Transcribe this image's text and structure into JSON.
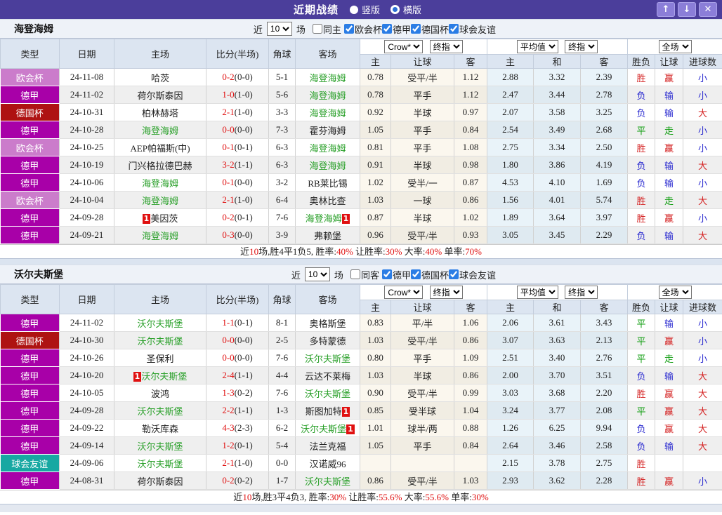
{
  "titlebar": {
    "title": "近期战绩",
    "radios": [
      {
        "label": "竖版",
        "selected": true
      },
      {
        "label": "横版",
        "selected": false
      }
    ],
    "buttons": {
      "up": "↑",
      "down": "↓",
      "close": "✕"
    }
  },
  "shared": {
    "near_label": "近",
    "games_label": "场",
    "columns_left": [
      "类型",
      "日期",
      "主场",
      "比分(半场)",
      "角球",
      "客场"
    ],
    "columns_right": [
      "主",
      "让球",
      "客",
      "主",
      "和",
      "客",
      "胜负",
      "让球",
      "进球数"
    ],
    "dropdowns": {
      "company": "Crow*",
      "final1": "终指",
      "average": "平均值",
      "final2": "终指",
      "scope": "全场"
    },
    "card_label": "1",
    "league_colors": {
      "欧会杯": "#cb7ccb",
      "德甲": "#a800a8",
      "德国杯": "#ae1212",
      "球会友谊": "#17a8a2"
    },
    "result_colors": {
      "胜": "#d42222",
      "赢": "#d42222",
      "大": "#d42222",
      "负": "#2b2bd0",
      "输": "#2b2bd0",
      "小": "#2b2bd0",
      "平": "#0f9d0f",
      "走": "#0f9d0f"
    },
    "colors": {
      "titlebar_purple": "#4b3e9b",
      "checkbox_blue": "#2b7de5",
      "score_red": "#e01010",
      "team_green": "#2aa02a"
    }
  },
  "tables": [
    {
      "team": "海登海姆",
      "games_count": "10",
      "same_side_label": "同主",
      "filters": [
        "欧会杯",
        "德甲",
        "德国杯",
        "球会友谊"
      ],
      "rows": [
        {
          "league": "欧会杯",
          "date": "24-11-08",
          "home": {
            "name": "哈茨",
            "green": false,
            "card": false
          },
          "score": "0-2",
          "half": "(0-0)",
          "corners": "5-1",
          "away": {
            "name": "海登海姆",
            "green": true,
            "card": false
          },
          "crow": [
            "0.78",
            "受平/半",
            "1.12"
          ],
          "avg": [
            "2.88",
            "3.32",
            "2.39"
          ],
          "results": [
            "胜",
            "赢",
            "小"
          ]
        },
        {
          "league": "德甲",
          "date": "24-11-02",
          "home": {
            "name": "荷尔斯泰因",
            "green": false,
            "card": false
          },
          "score": "1-0",
          "half": "(1-0)",
          "corners": "5-6",
          "away": {
            "name": "海登海姆",
            "green": true,
            "card": false
          },
          "crow": [
            "0.78",
            "平手",
            "1.12"
          ],
          "avg": [
            "2.47",
            "3.44",
            "2.78"
          ],
          "results": [
            "负",
            "输",
            "小"
          ]
        },
        {
          "league": "德国杯",
          "date": "24-10-31",
          "home": {
            "name": "柏林赫塔",
            "green": false,
            "card": false
          },
          "score": "2-1",
          "half": "(1-0)",
          "corners": "3-3",
          "away": {
            "name": "海登海姆",
            "green": true,
            "card": false
          },
          "crow": [
            "0.92",
            "半球",
            "0.97"
          ],
          "avg": [
            "2.07",
            "3.58",
            "3.25"
          ],
          "results": [
            "负",
            "输",
            "大"
          ]
        },
        {
          "league": "德甲",
          "date": "24-10-28",
          "home": {
            "name": "海登海姆",
            "green": true,
            "card": false
          },
          "score": "0-0",
          "half": "(0-0)",
          "corners": "7-3",
          "away": {
            "name": "霍芬海姆",
            "green": false,
            "card": false
          },
          "crow": [
            "1.05",
            "平手",
            "0.84"
          ],
          "avg": [
            "2.54",
            "3.49",
            "2.68"
          ],
          "results": [
            "平",
            "走",
            "小"
          ]
        },
        {
          "league": "欧会杯",
          "date": "24-10-25",
          "home": {
            "name": "AEP帕福斯(中)",
            "green": false,
            "card": false
          },
          "score": "0-1",
          "half": "(0-1)",
          "corners": "6-3",
          "away": {
            "name": "海登海姆",
            "green": true,
            "card": false
          },
          "crow": [
            "0.81",
            "平手",
            "1.08"
          ],
          "avg": [
            "2.75",
            "3.34",
            "2.50"
          ],
          "results": [
            "胜",
            "赢",
            "小"
          ]
        },
        {
          "league": "德甲",
          "date": "24-10-19",
          "home": {
            "name": "门兴格拉德巴赫",
            "green": false,
            "card": false
          },
          "score": "3-2",
          "half": "(1-1)",
          "corners": "6-3",
          "away": {
            "name": "海登海姆",
            "green": true,
            "card": false
          },
          "crow": [
            "0.91",
            "半球",
            "0.98"
          ],
          "avg": [
            "1.80",
            "3.86",
            "4.19"
          ],
          "results": [
            "负",
            "输",
            "大"
          ]
        },
        {
          "league": "德甲",
          "date": "24-10-06",
          "home": {
            "name": "海登海姆",
            "green": true,
            "card": false
          },
          "score": "0-1",
          "half": "(0-0)",
          "corners": "3-2",
          "away": {
            "name": "RB莱比锡",
            "green": false,
            "card": false
          },
          "crow": [
            "1.02",
            "受半/一",
            "0.87"
          ],
          "avg": [
            "4.53",
            "4.10",
            "1.69"
          ],
          "results": [
            "负",
            "输",
            "小"
          ]
        },
        {
          "league": "欧会杯",
          "date": "24-10-04",
          "home": {
            "name": "海登海姆",
            "green": true,
            "card": false
          },
          "score": "2-1",
          "half": "(1-0)",
          "corners": "6-4",
          "away": {
            "name": "奥林比查",
            "green": false,
            "card": false
          },
          "crow": [
            "1.03",
            "一球",
            "0.86"
          ],
          "avg": [
            "1.56",
            "4.01",
            "5.74"
          ],
          "results": [
            "胜",
            "走",
            "大"
          ]
        },
        {
          "league": "德甲",
          "date": "24-09-28",
          "home": {
            "name": "美因茨",
            "green": false,
            "card": true
          },
          "score": "0-2",
          "half": "(0-1)",
          "corners": "7-6",
          "away": {
            "name": "海登海姆",
            "green": true,
            "card": true
          },
          "crow": [
            "0.87",
            "半球",
            "1.02"
          ],
          "avg": [
            "1.89",
            "3.64",
            "3.97"
          ],
          "results": [
            "胜",
            "赢",
            "小"
          ]
        },
        {
          "league": "德甲",
          "date": "24-09-21",
          "home": {
            "name": "海登海姆",
            "green": true,
            "card": false
          },
          "score": "0-3",
          "half": "(0-0)",
          "corners": "3-9",
          "away": {
            "name": "弗赖堡",
            "green": false,
            "card": false
          },
          "crow": [
            "0.96",
            "受平/半",
            "0.93"
          ],
          "avg": [
            "3.05",
            "3.45",
            "2.29"
          ],
          "results": [
            "负",
            "输",
            "大"
          ]
        }
      ],
      "summary": [
        {
          "text": "近",
          "red": false
        },
        {
          "text": "10",
          "red": true
        },
        {
          "text": "场,胜4平1负5, 胜率:",
          "red": false
        },
        {
          "text": "40%",
          "red": true
        },
        {
          "text": " 让胜率:",
          "red": false
        },
        {
          "text": "30%",
          "red": true
        },
        {
          "text": " 大率:",
          "red": false
        },
        {
          "text": "40%",
          "red": true
        },
        {
          "text": " 单率:",
          "red": false
        },
        {
          "text": "70%",
          "red": true
        }
      ]
    },
    {
      "team": "沃尔夫斯堡",
      "games_count": "10",
      "same_side_label": "同客",
      "filters": [
        "德甲",
        "德国杯",
        "球会友谊"
      ],
      "rows": [
        {
          "league": "德甲",
          "date": "24-11-02",
          "home": {
            "name": "沃尔夫斯堡",
            "green": true,
            "card": false
          },
          "score": "1-1",
          "half": "(0-1)",
          "corners": "8-1",
          "away": {
            "name": "奥格斯堡",
            "green": false,
            "card": false
          },
          "crow": [
            "0.83",
            "平/半",
            "1.06"
          ],
          "avg": [
            "2.06",
            "3.61",
            "3.43"
          ],
          "results": [
            "平",
            "输",
            "小"
          ]
        },
        {
          "league": "德国杯",
          "date": "24-10-30",
          "home": {
            "name": "沃尔夫斯堡",
            "green": true,
            "card": false
          },
          "score": "0-0",
          "half": "(0-0)",
          "corners": "2-5",
          "away": {
            "name": "多特蒙德",
            "green": false,
            "card": false
          },
          "crow": [
            "1.03",
            "受平/半",
            "0.86"
          ],
          "avg": [
            "3.07",
            "3.63",
            "2.13"
          ],
          "results": [
            "平",
            "赢",
            "小"
          ]
        },
        {
          "league": "德甲",
          "date": "24-10-26",
          "home": {
            "name": "圣保利",
            "green": false,
            "card": false
          },
          "score": "0-0",
          "half": "(0-0)",
          "corners": "7-6",
          "away": {
            "name": "沃尔夫斯堡",
            "green": true,
            "card": false
          },
          "crow": [
            "0.80",
            "平手",
            "1.09"
          ],
          "avg": [
            "2.51",
            "3.40",
            "2.76"
          ],
          "results": [
            "平",
            "走",
            "小"
          ]
        },
        {
          "league": "德甲",
          "date": "24-10-20",
          "home": {
            "name": "沃尔夫斯堡",
            "green": true,
            "card": true
          },
          "score": "2-4",
          "half": "(1-1)",
          "corners": "4-4",
          "away": {
            "name": "云达不莱梅",
            "green": false,
            "card": false
          },
          "crow": [
            "1.03",
            "半球",
            "0.86"
          ],
          "avg": [
            "2.00",
            "3.70",
            "3.51"
          ],
          "results": [
            "负",
            "输",
            "大"
          ]
        },
        {
          "league": "德甲",
          "date": "24-10-05",
          "home": {
            "name": "波鸿",
            "green": false,
            "card": false
          },
          "score": "1-3",
          "half": "(0-2)",
          "corners": "7-6",
          "away": {
            "name": "沃尔夫斯堡",
            "green": true,
            "card": false
          },
          "crow": [
            "0.90",
            "受平/半",
            "0.99"
          ],
          "avg": [
            "3.03",
            "3.68",
            "2.20"
          ],
          "results": [
            "胜",
            "赢",
            "大"
          ]
        },
        {
          "league": "德甲",
          "date": "24-09-28",
          "home": {
            "name": "沃尔夫斯堡",
            "green": true,
            "card": false
          },
          "score": "2-2",
          "half": "(1-1)",
          "corners": "1-3",
          "away": {
            "name": "斯图加特",
            "green": false,
            "card": true
          },
          "crow": [
            "0.85",
            "受半球",
            "1.04"
          ],
          "avg": [
            "3.24",
            "3.77",
            "2.08"
          ],
          "results": [
            "平",
            "赢",
            "大"
          ]
        },
        {
          "league": "德甲",
          "date": "24-09-22",
          "home": {
            "name": "勒沃库森",
            "green": false,
            "card": false
          },
          "score": "4-3",
          "half": "(2-3)",
          "corners": "6-2",
          "away": {
            "name": "沃尔夫斯堡",
            "green": true,
            "card": true
          },
          "crow": [
            "1.01",
            "球半/两",
            "0.88"
          ],
          "avg": [
            "1.26",
            "6.25",
            "9.94"
          ],
          "results": [
            "负",
            "赢",
            "大"
          ]
        },
        {
          "league": "德甲",
          "date": "24-09-14",
          "home": {
            "name": "沃尔夫斯堡",
            "green": true,
            "card": false
          },
          "score": "1-2",
          "half": "(0-1)",
          "corners": "5-4",
          "away": {
            "name": "法兰克福",
            "green": false,
            "card": false
          },
          "crow": [
            "1.05",
            "平手",
            "0.84"
          ],
          "avg": [
            "2.64",
            "3.46",
            "2.58"
          ],
          "results": [
            "负",
            "输",
            "大"
          ]
        },
        {
          "league": "球会友谊",
          "date": "24-09-06",
          "home": {
            "name": "沃尔夫斯堡",
            "green": true,
            "card": false
          },
          "score": "2-1",
          "half": "(1-0)",
          "corners": "0-0",
          "away": {
            "name": "汉诺威96",
            "green": false,
            "card": false
          },
          "crow": [
            "",
            "",
            ""
          ],
          "avg": [
            "2.15",
            "3.78",
            "2.75"
          ],
          "results": [
            "胜",
            "",
            ""
          ]
        },
        {
          "league": "德甲",
          "date": "24-08-31",
          "home": {
            "name": "荷尔斯泰因",
            "green": false,
            "card": false
          },
          "score": "0-2",
          "half": "(0-2)",
          "corners": "1-7",
          "away": {
            "name": "沃尔夫斯堡",
            "green": true,
            "card": false
          },
          "crow": [
            "0.86",
            "受平/半",
            "1.03"
          ],
          "avg": [
            "2.93",
            "3.62",
            "2.28"
          ],
          "results": [
            "胜",
            "赢",
            "小"
          ]
        }
      ],
      "summary": [
        {
          "text": "近",
          "red": false
        },
        {
          "text": "10",
          "red": true
        },
        {
          "text": "场,胜3平4负3, 胜率:",
          "red": false
        },
        {
          "text": "30%",
          "red": true
        },
        {
          "text": " 让胜率:",
          "red": false
        },
        {
          "text": "55.6%",
          "red": true
        },
        {
          "text": " 大率:",
          "red": false
        },
        {
          "text": "55.6%",
          "red": true
        },
        {
          "text": " 单率:",
          "red": false
        },
        {
          "text": "30%",
          "red": true
        }
      ]
    }
  ]
}
